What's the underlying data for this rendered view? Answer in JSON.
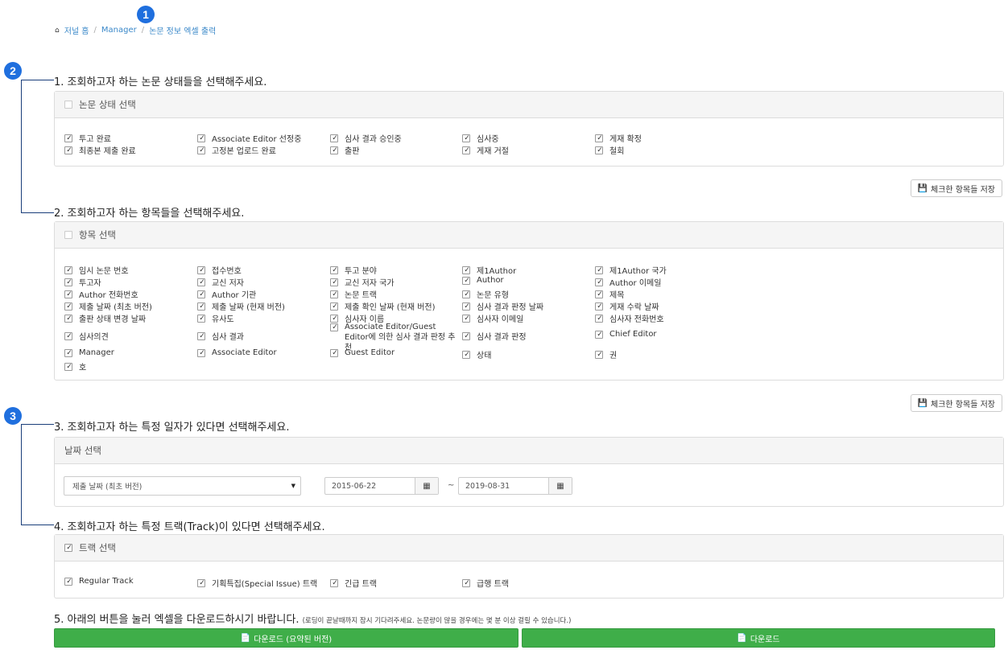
{
  "annotations": [
    "1",
    "2",
    "3"
  ],
  "breadcrumb": {
    "home": "저널 홈",
    "sep1": "/",
    "manager": "Manager",
    "sep2": "/",
    "current": "논문 정보 엑셀 출력"
  },
  "step1": {
    "title": "1. 조회하고자 하는 논문 상태들을 선택해주세요.",
    "panel_title": "논문 상태 선택",
    "items": [
      "투고 완료",
      "Associate Editor 선정중",
      "심사 결과 승인중",
      "심사중",
      "게재 확정",
      "최종본 제출 완료",
      "고정본 업로드 완료",
      "출판",
      "게재 거절",
      "철회"
    ]
  },
  "save_button": "체크한 항목들 저장",
  "step2": {
    "title": "2. 조회하고자 하는 항목들을 선택해주세요.",
    "panel_title": "항목 선택",
    "items": [
      "임시 논문 번호",
      "접수번호",
      "투고 분야",
      "제1Author",
      "제1Author 국가",
      "투고자",
      "교신 저자",
      "교신 저자 국가",
      "Author",
      "Author 이메일",
      "Author 전화번호",
      "Author 기관",
      "논문 트랙",
      "논문 유형",
      "제목",
      "제출 날짜 (최초 버전)",
      "제출 날짜 (현재 버전)",
      "제출 확인 날짜 (현재 버전)",
      "심사 결과 판정 날짜",
      "게재 수락 날짜",
      "출판 상태 변경 날짜",
      "유사도",
      "심사자 이름",
      "심사자 이메일",
      "심사자 전화번호",
      "심사의견",
      "심사 결과",
      "Associate Editor/Guest Editor에 의한 심사 결과 판정 추천",
      "심사 결과 판정",
      "Chief Editor",
      "Manager",
      "Associate Editor",
      "Guest Editor",
      "상태",
      "권",
      "호"
    ]
  },
  "step3": {
    "title": "3. 조회하고자 하는 특정 일자가 있다면 선택해주세요.",
    "panel_title": "날짜 선택",
    "date_type": "제출 날짜 (최초 버전)",
    "date_from": "2015-06-22",
    "tilde": "~",
    "date_to": "2019-08-31"
  },
  "step4": {
    "title": "4. 조회하고자 하는 특정 트랙(Track)이 있다면 선택해주세요.",
    "panel_title": "트랙 선택",
    "items": [
      "Regular Track",
      "기획특집(Special Issue) 트랙",
      "긴급 트랙",
      "급행 트랙"
    ]
  },
  "step5": {
    "title": "5. 아래의 버튼을 눌러 엑셀을 다운로드하시기 바랍니다.",
    "note": "(로딩이 끝날때까지 잠시 기다려주세요. 논문량이 많을 경우에는 몇 분 이상 걸릴 수 있습니다.)",
    "btn_summary": "다운로드 (요약된 버전)",
    "btn_full": "다운로드"
  },
  "colors": {
    "accent": "#1f6fde",
    "download": "#3fae49",
    "link": "#3a88c9"
  }
}
